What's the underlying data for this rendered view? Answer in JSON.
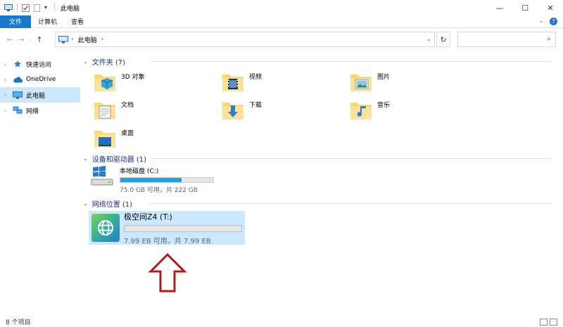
{
  "window": {
    "title": "此电脑",
    "controls": {
      "minimize": "—",
      "maximize": "☐",
      "close": "✕"
    }
  },
  "ribbon": {
    "file_tab": "文件",
    "tabs": [
      "计算机",
      "查看"
    ],
    "help": "?"
  },
  "address": {
    "crumb": "此电脑",
    "search_placeholder": ""
  },
  "nav_pane": {
    "items": [
      {
        "label": "快速访问",
        "icon": "star-icon"
      },
      {
        "label": "OneDrive",
        "icon": "cloud-icon"
      },
      {
        "label": "此电脑",
        "icon": "computer-icon",
        "selected": true
      },
      {
        "label": "网络",
        "icon": "network-icon"
      }
    ]
  },
  "groups": {
    "folders_header": "文件夹 (7)",
    "drives_header": "设备和驱动器 (1)",
    "network_header": "网络位置 (1)"
  },
  "folders": [
    {
      "name": "3D 对象",
      "icon": "3d-objects-folder-icon"
    },
    {
      "name": "视频",
      "icon": "videos-folder-icon"
    },
    {
      "name": "图片",
      "icon": "pictures-folder-icon"
    },
    {
      "name": "文档",
      "icon": "documents-folder-icon"
    },
    {
      "name": "下载",
      "icon": "downloads-folder-icon"
    },
    {
      "name": "音乐",
      "icon": "music-folder-icon"
    },
    {
      "name": "桌面",
      "icon": "desktop-folder-icon"
    }
  ],
  "drive": {
    "name": "本地磁盘 (C:)",
    "free_text": "75.0 GB 可用，共 222 GB",
    "used_fraction": 0.66
  },
  "network_location": {
    "name": "极空间Z4 (T:)",
    "free_text": "7.99 EB 可用，共 7.99 EB",
    "used_fraction": 0.0
  },
  "status": {
    "count": "8 个项目"
  },
  "colors": {
    "accent": "#1979ca",
    "selection": "#cce8ff",
    "bar_fill": "#26a0da",
    "arrow": "#b01c1c"
  }
}
